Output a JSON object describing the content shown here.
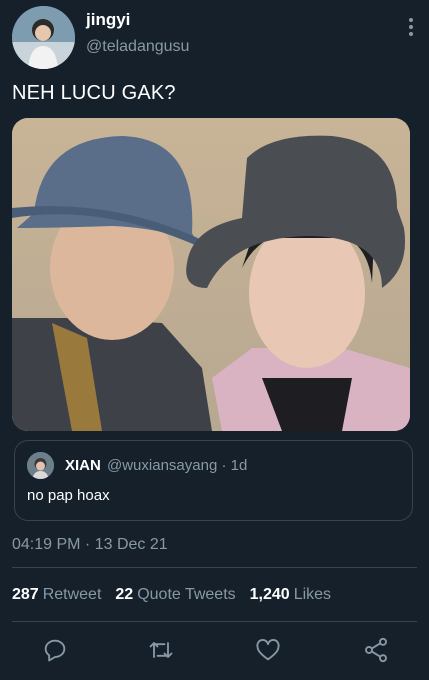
{
  "user": {
    "name": "jingyi",
    "handle": "@teladangusu"
  },
  "tweet": {
    "text": "NEH LUCU GAK?",
    "timestamp": "04:19 PM · 13 Dec 21"
  },
  "quote": {
    "name": "XIAN",
    "handle_time": "@wuxiansayang · 1d",
    "text": "no pap hoax"
  },
  "stats": {
    "retweets": "287",
    "retweets_label": "Retweet",
    "quotes": "22",
    "quotes_label": "Quote Tweets",
    "likes": "1,240",
    "likes_label": "Likes"
  },
  "icons": {
    "more": "more-vertical-icon",
    "reply": "reply-icon",
    "retweet": "retweet-icon",
    "like": "heart-icon",
    "share": "share-icon"
  },
  "colors": {
    "background": "#15202b",
    "secondary_text": "#8899a6",
    "border": "#38444d"
  }
}
